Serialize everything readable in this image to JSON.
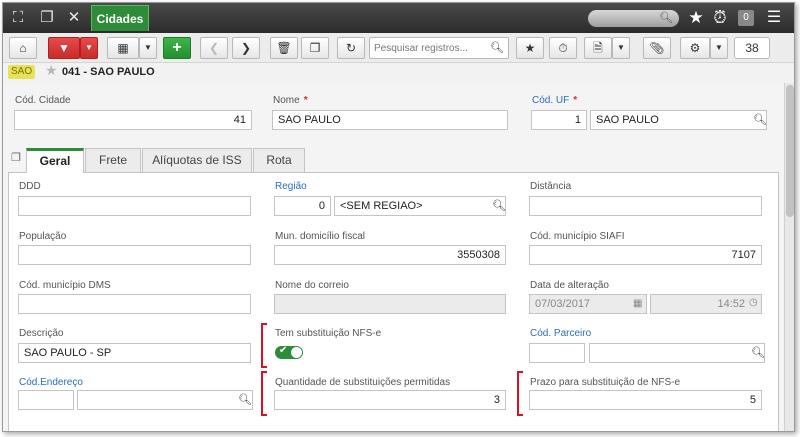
{
  "titlebar": {
    "tab_label": "Cidades",
    "count_badge": "0",
    "icons": [
      "fullscreen-icon",
      "restore-icon",
      "close-icon",
      "search-icon",
      "star-icon",
      "alarm-icon",
      "menu-icon"
    ]
  },
  "toolbar": {
    "search_placeholder": "Pesquisar registros...",
    "page_number": "38"
  },
  "record": {
    "badge": "SAO",
    "title": "041 - SAO PAULO"
  },
  "header_fields": {
    "cod_cidade": {
      "label": "Cód. Cidade",
      "value": "41"
    },
    "nome": {
      "label": "Nome",
      "value": "SAO PAULO",
      "required_mark": "*"
    },
    "cod_uf": {
      "label": "Cód. UF",
      "code": "1",
      "value": "SAO PAULO",
      "required_mark": "*"
    }
  },
  "tabs": [
    {
      "label": "Geral",
      "active": true
    },
    {
      "label": "Frete",
      "active": false
    },
    {
      "label": "Alíquotas de ISS",
      "active": false
    },
    {
      "label": "Rota",
      "active": false
    }
  ],
  "geral": {
    "ddd": {
      "label": "DDD",
      "value": ""
    },
    "regiao": {
      "label": "Região",
      "code": "0",
      "value": "<SEM REGIAO>"
    },
    "distancia": {
      "label": "Distância",
      "value": ""
    },
    "populacao": {
      "label": "População",
      "value": ""
    },
    "mun_domicilio_fiscal": {
      "label": "Mun. domicílio fiscal",
      "value": "3550308"
    },
    "cod_municipio_siafi": {
      "label": "Cód. município SIAFI",
      "value": "7107"
    },
    "cod_municipio_dms": {
      "label": "Cód. município DMS",
      "value": ""
    },
    "nome_correio": {
      "label": "Nome do correio",
      "value": ""
    },
    "data_alteracao": {
      "label": "Data de alteração",
      "date": "07/03/2017",
      "time": "14:52"
    },
    "descricao": {
      "label": "Descrição",
      "value": "SAO PAULO - SP"
    },
    "tem_substituicao_nfse": {
      "label": "Tem substituição NFS-e",
      "enabled": true
    },
    "cod_parceiro": {
      "label": "Cód. Parceiro",
      "code": "",
      "value": ""
    },
    "cod_endereco": {
      "label": "Cód.Endereço",
      "code": "",
      "value": ""
    },
    "qtd_substituicoes": {
      "label": "Quantidade de substituições permitidas",
      "value": "3"
    },
    "prazo_substituicao": {
      "label": "Prazo para substituição de NFS-e",
      "value": "5"
    }
  },
  "colors": {
    "accent_green": "#2e8b3a",
    "delete_red": "#d92b2b",
    "link_blue": "#2a6dc0",
    "annotation_red": "#d8121e"
  }
}
